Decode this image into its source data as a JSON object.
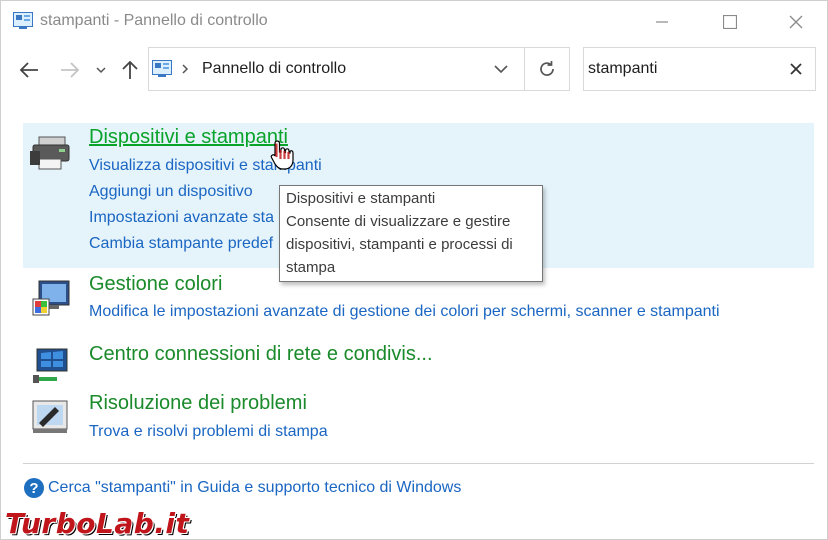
{
  "window": {
    "title": "stampanti - Pannello di controllo"
  },
  "nav": {
    "address": "Pannello di controllo",
    "search_value": "stampanti"
  },
  "results": [
    {
      "title": "Dispositivi e stampanti",
      "icon": "printer-device-icon",
      "links": [
        "Visualizza dispositivi e stampanti",
        "Aggiungi un dispositivo",
        "Impostazioni avanzate sta",
        "Cambia stampante predef"
      ]
    },
    {
      "title": "Gestione colori",
      "icon": "color-management-icon",
      "links": [
        "Modifica le impostazioni avanzate di gestione dei colori per schermi, scanner e stampanti"
      ]
    },
    {
      "title": "Centro connessioni di rete e condivis...",
      "icon": "network-center-icon",
      "links": []
    },
    {
      "title": "Risoluzione dei problemi",
      "icon": "troubleshooting-icon",
      "links": [
        "Trova e risolvi problemi di stampa"
      ]
    }
  ],
  "help": {
    "text": "Cerca \"stampanti\" in Guida e supporto tecnico di Windows"
  },
  "tooltip": {
    "lines": [
      "Dispositivi e stampanti",
      "Consente di visualizzare e gestire",
      "dispositivi, stampanti e processi di",
      "stampa"
    ]
  },
  "watermark": {
    "text": "TurboLab.it"
  },
  "colors": {
    "title_green": "#1a8a2a",
    "link_blue": "#1a66c2",
    "highlight_bg": "#e5f3fb"
  }
}
